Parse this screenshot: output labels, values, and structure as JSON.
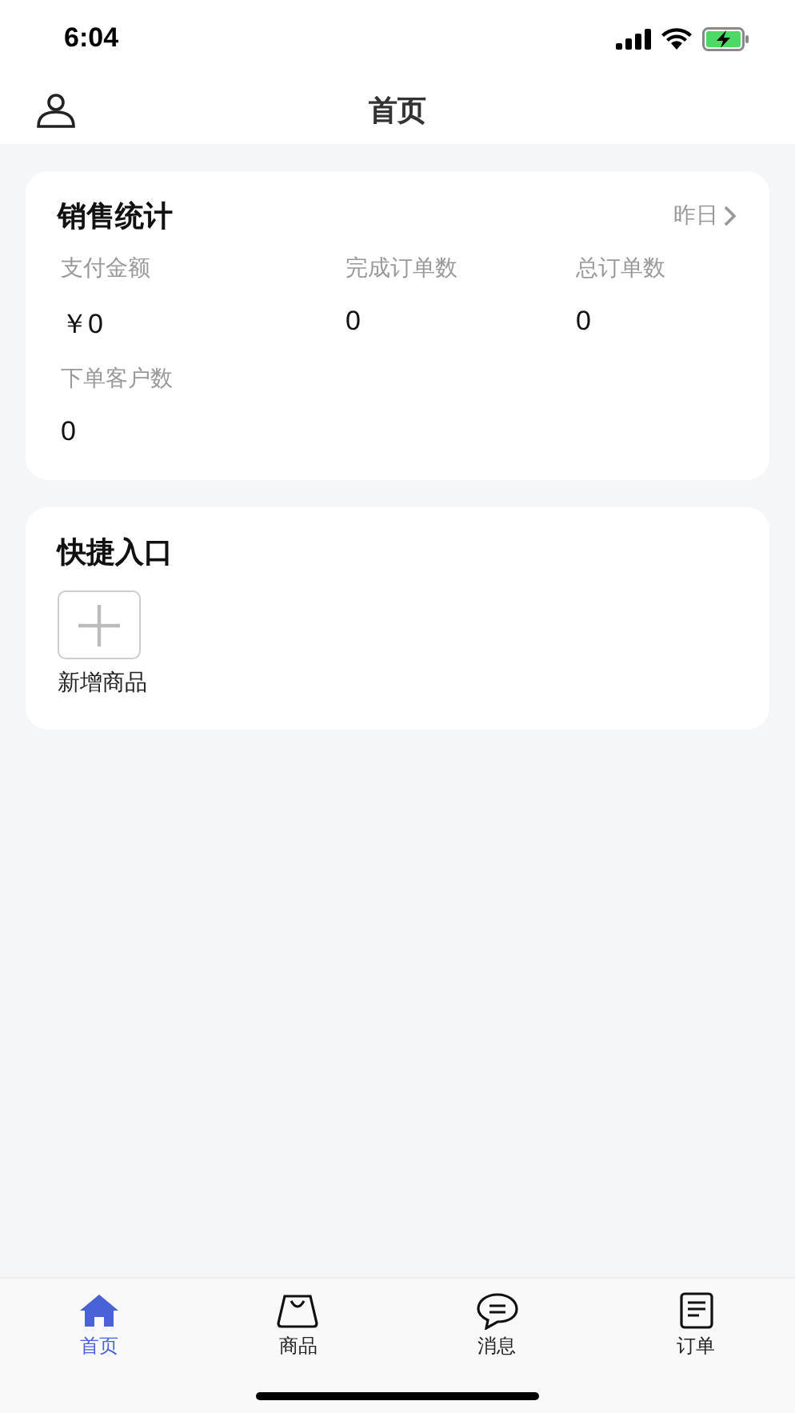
{
  "status_bar": {
    "time": "6:04",
    "battery_charging": true
  },
  "nav": {
    "title": "首页"
  },
  "sales": {
    "title": "销售统计",
    "period": "昨日",
    "stats": [
      {
        "label": "支付金额",
        "value": "￥0"
      },
      {
        "label": "完成订单数",
        "value": "0"
      },
      {
        "label": "总订单数",
        "value": "0"
      },
      {
        "label": "下单客户数",
        "value": "0"
      }
    ]
  },
  "shortcuts": {
    "title": "快捷入口",
    "items": [
      {
        "label": "新增商品"
      }
    ]
  },
  "tab_bar": [
    {
      "label": "首页",
      "kind": "home",
      "selected": true
    },
    {
      "label": "商品",
      "kind": "bag",
      "selected": false
    },
    {
      "label": "消息",
      "kind": "chat",
      "selected": false
    },
    {
      "label": "订单",
      "kind": "list",
      "selected": false
    }
  ]
}
